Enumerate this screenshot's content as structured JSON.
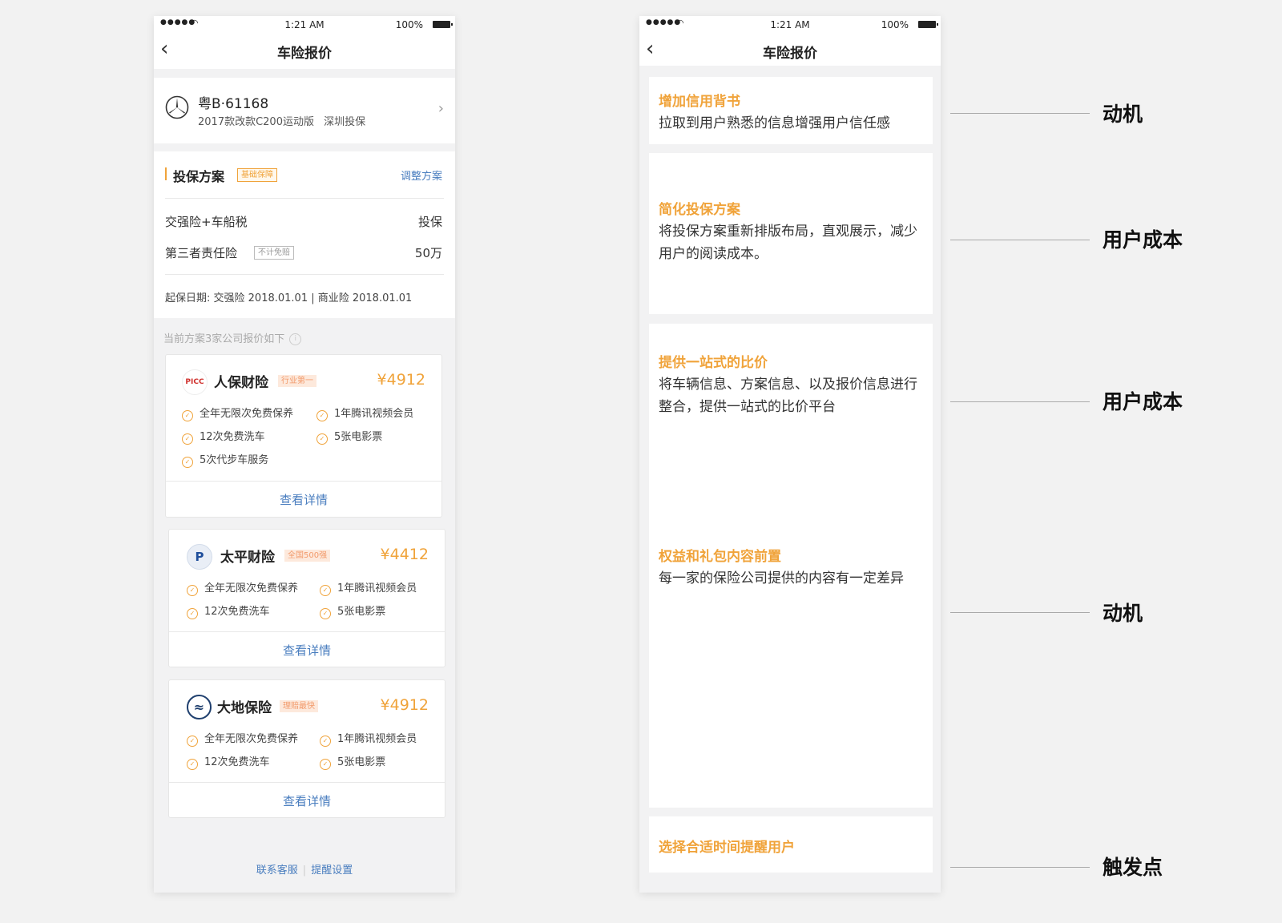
{
  "status": {
    "signal": "●●●●●",
    "time": "1:21 AM",
    "battery": "100%"
  },
  "nav": {
    "title": "车险报价"
  },
  "car": {
    "plate": "粤B·61168",
    "model": "2017款改款C200运动版",
    "location": "深圳投保"
  },
  "plan": {
    "title": "投保方案",
    "tag": "基础保障",
    "adjust": "调整方案",
    "rows": [
      {
        "label": "交强险+车船税",
        "value": "投保"
      },
      {
        "label": "第三者责任险",
        "tag": "不计免赔",
        "value": "50万"
      }
    ],
    "start_label": "起保日期:",
    "start_dates": "交强险 2018.01.01 | 商业险 2018.01.01"
  },
  "list_header": "当前方案3家公司报价如下",
  "quotes": [
    {
      "logo": "PICC",
      "name": "人保财险",
      "tag": "行业第一",
      "price": "¥4912",
      "perks": [
        "全年无限次免费保养",
        "1年腾讯视频会员",
        "12次免费洗车",
        "5张电影票",
        "5次代步车服务"
      ],
      "detail": "查看详情"
    },
    {
      "logo": "P",
      "name": "太平财险",
      "tag": "全国500强",
      "price": "¥4412",
      "perks": [
        "全年无限次免费保养",
        "1年腾讯视频会员",
        "12次免费洗车",
        "5张电影票"
      ],
      "detail": "查看详情"
    },
    {
      "logo": "≈",
      "name": "大地保险",
      "tag": "理赔最快",
      "price": "¥4912",
      "perks": [
        "全年无限次免费保养",
        "1年腾讯视频会员",
        "12次免费洗车",
        "5张电影票"
      ],
      "detail": "查看详情"
    }
  ],
  "footer": {
    "service": "联系客服",
    "separator": "|",
    "reminder": "提醒设置"
  },
  "annotations": [
    {
      "title": "增加信用背书",
      "body": "拉取到用户熟悉的信息增强用户信任感"
    },
    {
      "title": "简化投保方案",
      "body": "将投保方案重新排版布局，直观展示，减少用户的阅读成本。"
    },
    {
      "title": "提供一站式的比价",
      "body": "将车辆信息、方案信息、以及报价信息进行整合，提供一站式的比价平台"
    },
    {
      "title": "权益和礼包内容前置",
      "body": "每一家的保险公司提供的内容有一定差异"
    },
    {
      "title": "选择合适时间提醒用户",
      "body": ""
    }
  ],
  "callouts": [
    "动机",
    "用户成本",
    "用户成本",
    "动机",
    "触发点"
  ],
  "colors": {
    "accent": "#f0a33a",
    "link": "#4a7ebf",
    "tag_bg": "#fde9dc"
  }
}
